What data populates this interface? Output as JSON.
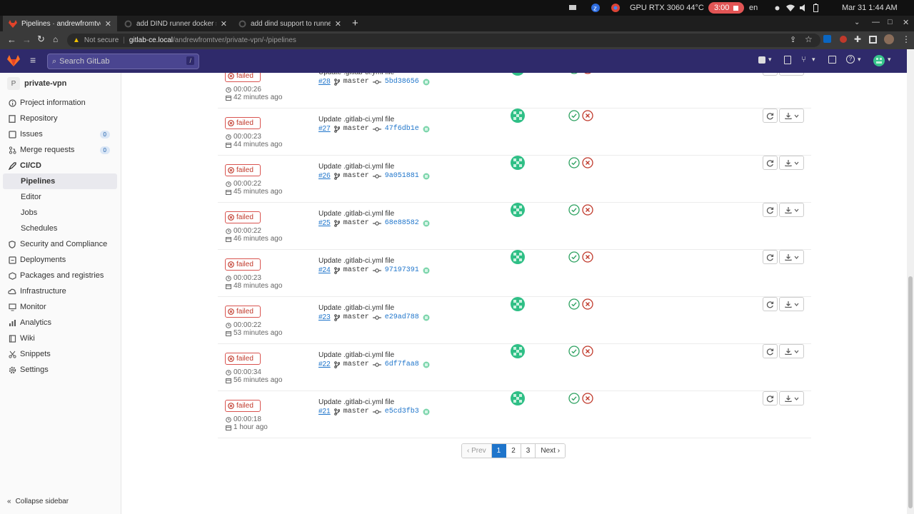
{
  "os": {
    "gpu": "GPU RTX 3060 44°C",
    "timer": "3:00",
    "lang": "en",
    "datetime": "Mar 31  1:44 AM"
  },
  "tabs": [
    {
      "title": "Pipelines · andrewfromtver /",
      "active": true
    },
    {
      "title": "add DIND runner docker subn",
      "active": false
    },
    {
      "title": "add dind support to runners",
      "active": false
    }
  ],
  "address": {
    "not_secure": "Not secure",
    "host": "gitlab-ce.local",
    "path": "/andrewfromtver/private-vpn/-/pipelines"
  },
  "header": {
    "search_placeholder": "Search GitLab",
    "search_shortcut": "/"
  },
  "sidebar": {
    "project_initial": "P",
    "project_name": "private-vpn",
    "items": [
      {
        "label": "Project information",
        "icon": "info-icon"
      },
      {
        "label": "Repository",
        "icon": "doc-icon"
      },
      {
        "label": "Issues",
        "icon": "issues-icon",
        "badge": "0"
      },
      {
        "label": "Merge requests",
        "icon": "merge-icon",
        "badge": "0"
      },
      {
        "label": "CI/CD",
        "icon": "rocket-icon"
      },
      {
        "label": "Pipelines",
        "sub": true,
        "active": true
      },
      {
        "label": "Editor",
        "sub": true
      },
      {
        "label": "Jobs",
        "sub": true
      },
      {
        "label": "Schedules",
        "sub": true
      },
      {
        "label": "Security and Compliance",
        "icon": "shield-icon"
      },
      {
        "label": "Deployments",
        "icon": "deploy-icon"
      },
      {
        "label": "Packages and registries",
        "icon": "package-icon"
      },
      {
        "label": "Infrastructure",
        "icon": "cloud-icon"
      },
      {
        "label": "Monitor",
        "icon": "monitor-icon"
      },
      {
        "label": "Analytics",
        "icon": "chart-icon"
      },
      {
        "label": "Wiki",
        "icon": "book-icon"
      },
      {
        "label": "Snippets",
        "icon": "scissors-icon"
      },
      {
        "label": "Settings",
        "icon": "gear-icon"
      }
    ],
    "collapse": "Collapse sidebar"
  },
  "pipelines": [
    {
      "status": "failed",
      "duration": "00:00:26",
      "finished": "42 minutes ago",
      "title": "Update .gitlab-ci.yml file",
      "id": "#28",
      "branch": "master",
      "sha": "5bd38656"
    },
    {
      "status": "failed",
      "duration": "00:00:23",
      "finished": "44 minutes ago",
      "title": "Update .gitlab-ci.yml file",
      "id": "#27",
      "branch": "master",
      "sha": "47f6db1e"
    },
    {
      "status": "failed",
      "duration": "00:00:22",
      "finished": "45 minutes ago",
      "title": "Update .gitlab-ci.yml file",
      "id": "#26",
      "branch": "master",
      "sha": "9a051881"
    },
    {
      "status": "failed",
      "duration": "00:00:22",
      "finished": "46 minutes ago",
      "title": "Update .gitlab-ci.yml file",
      "id": "#25",
      "branch": "master",
      "sha": "68e88582"
    },
    {
      "status": "failed",
      "duration": "00:00:23",
      "finished": "48 minutes ago",
      "title": "Update .gitlab-ci.yml file",
      "id": "#24",
      "branch": "master",
      "sha": "97197391"
    },
    {
      "status": "failed",
      "duration": "00:00:22",
      "finished": "53 minutes ago",
      "title": "Update .gitlab-ci.yml file",
      "id": "#23",
      "branch": "master",
      "sha": "e29ad788"
    },
    {
      "status": "failed",
      "duration": "00:00:34",
      "finished": "56 minutes ago",
      "title": "Update .gitlab-ci.yml file",
      "id": "#22",
      "branch": "master",
      "sha": "6df7faa8"
    },
    {
      "status": "failed",
      "duration": "00:00:18",
      "finished": "1 hour ago",
      "title": "Update .gitlab-ci.yml file",
      "id": "#21",
      "branch": "master",
      "sha": "e5cd3fb3"
    }
  ],
  "pagination": {
    "prev": "‹ Prev",
    "pages": [
      "1",
      "2",
      "3"
    ],
    "current": "1",
    "next": "Next ›"
  },
  "colors": {
    "header_bg": "#2f2a6b",
    "failed": "#c0392b",
    "success": "#2da160",
    "link": "#1f75cb"
  }
}
